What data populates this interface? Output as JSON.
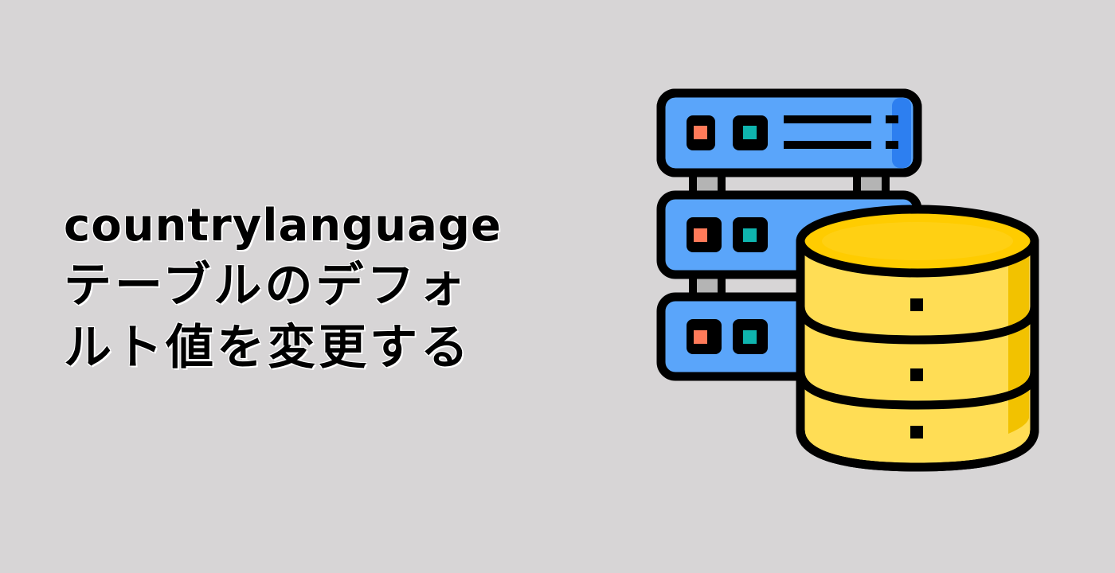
{
  "title": {
    "line1": "countrylanguage",
    "line2": "テーブルのデフォ",
    "line3": "ルト値を変更する"
  },
  "illustration": {
    "icon": "database-server-icon",
    "colors": {
      "server_body": "#5aa5fa",
      "server_edge": "#2d7ff0",
      "led_orange": "#ff7a59",
      "led_teal": "#0fb5ae",
      "connector": "#b4b4b4",
      "db_body": "#ffdd55",
      "db_top": "#ffcc00",
      "db_shade": "#f2c200",
      "outline": "#000000"
    }
  }
}
